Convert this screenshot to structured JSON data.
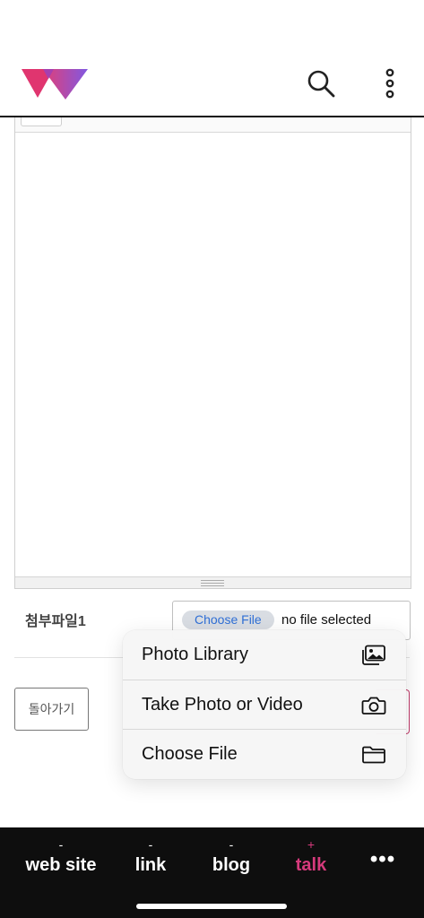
{
  "colors": {
    "accent": "#d63a7c",
    "logo_pink": "#e0356f",
    "logo_purple": "#7a4fe0",
    "nav_background": "#0e0e0e",
    "file_button_text": "#2f6fd6"
  },
  "header": {
    "logo_icon": "brand-w-logo",
    "search_icon": "search-icon",
    "more_icon": "vertical-ellipsis-icon"
  },
  "form": {
    "attachment_label": "첨부파일1",
    "file_input": {
      "button_label": "Choose File",
      "status_text": "no file selected"
    },
    "back_button_label": "돌아가기"
  },
  "popup_menu": {
    "items": [
      {
        "label": "Photo Library",
        "icon": "photo-library-icon"
      },
      {
        "label": "Take Photo or Video",
        "icon": "camera-icon"
      },
      {
        "label": "Choose File",
        "icon": "folder-icon"
      }
    ]
  },
  "bottom_nav": {
    "items": [
      {
        "mark": "-",
        "label": "web site",
        "active": false
      },
      {
        "mark": "-",
        "label": "link",
        "active": false
      },
      {
        "mark": "-",
        "label": "blog",
        "active": false
      },
      {
        "mark": "+",
        "label": "talk",
        "active": true
      }
    ],
    "more_label": "•••"
  }
}
